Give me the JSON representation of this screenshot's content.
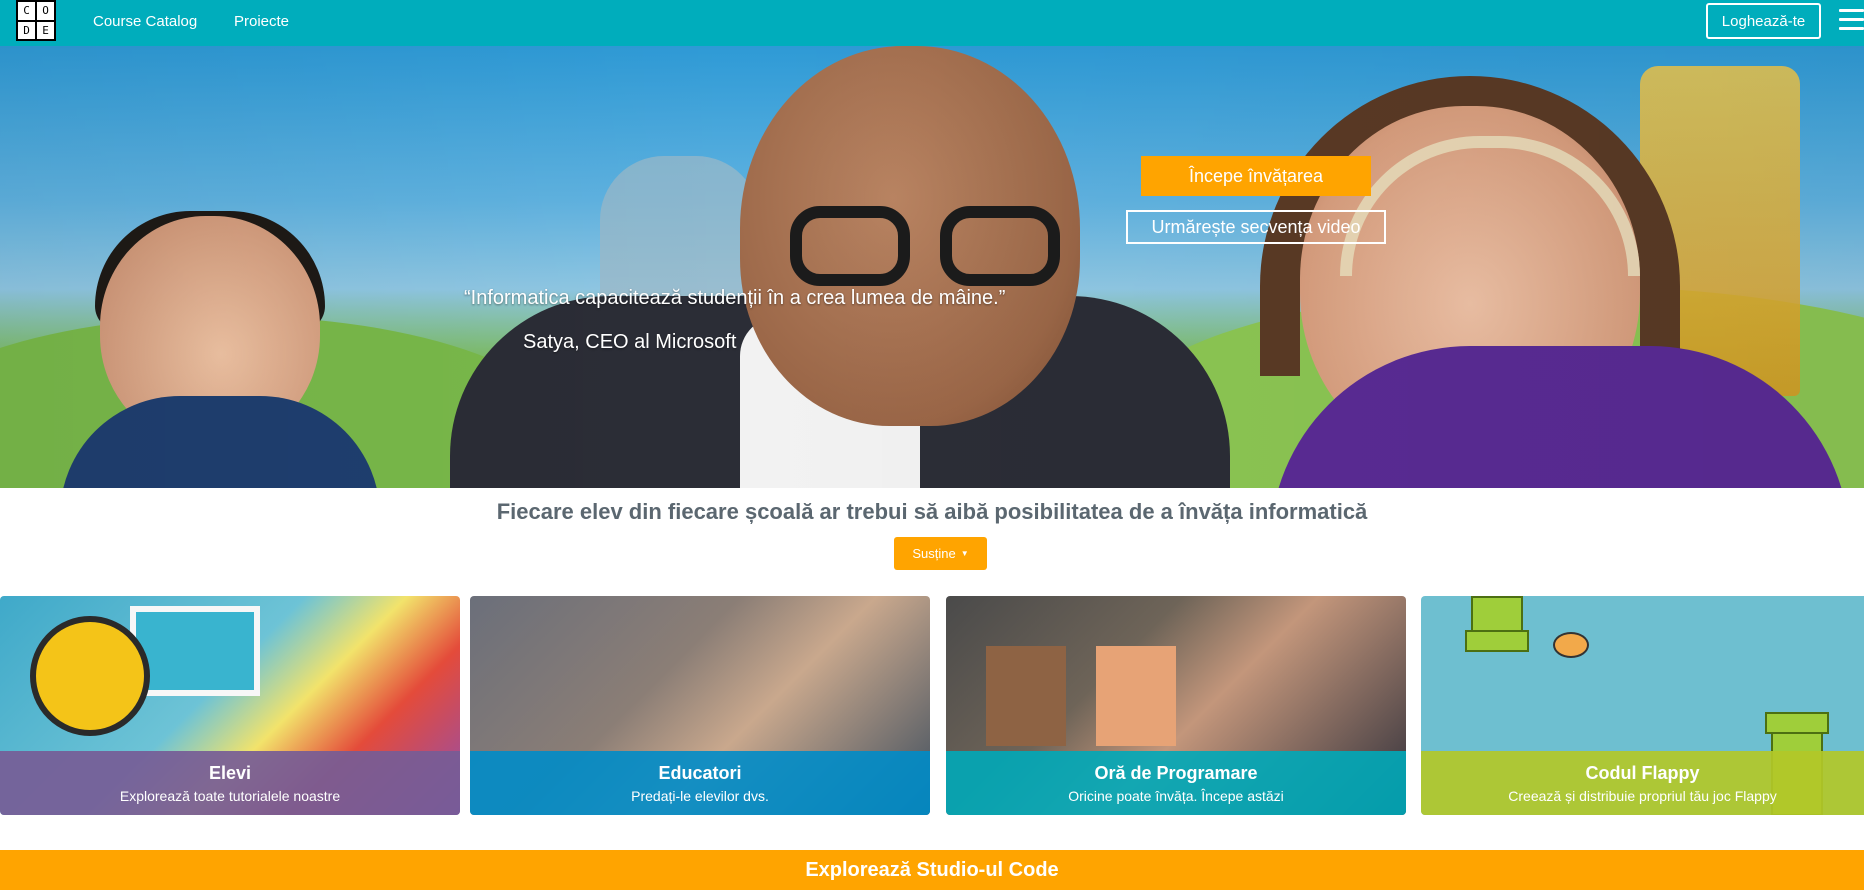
{
  "header": {
    "logo": {
      "letters": [
        "C",
        "O",
        "D",
        "E"
      ]
    },
    "nav": [
      {
        "label": "Course Catalog"
      },
      {
        "label": "Proiecte"
      }
    ],
    "signin_label": "Loghează-te",
    "menu_icon": "hamburger-icon",
    "bg_color": "#00adbc"
  },
  "hero": {
    "quote": "“Informatica capacitează studenții în a crea lumea de mâine.”",
    "author": "Satya, CEO al Microsoft",
    "start_button": "Începe învățarea",
    "video_button": "Urmărește secvența video"
  },
  "tagline": "Fiecare elev din fiecare școală ar trebui să aibă posibilitatea de a învăța informatică",
  "support_button": {
    "label": "Susține",
    "icon": "caret-down-icon"
  },
  "tiles": [
    {
      "title": "Elevi",
      "subtitle": "Explorează toate tutorialele noastre",
      "color": "#765c96"
    },
    {
      "title": "Educatori",
      "subtitle": "Predați-le elevilor dvs.",
      "color": "#008cc8"
    },
    {
      "title": "Oră de Programare",
      "subtitle": "Oricine poate învăța. Începe astăzi",
      "color": "#00a8b8"
    },
    {
      "title": "Codul Flappy",
      "subtitle": "Creează și distribuie propriul tău joc Flappy",
      "color": "#b2c828"
    }
  ],
  "studio_bar": "Explorează Studio-ul Code",
  "accent_color": "#ffa400"
}
